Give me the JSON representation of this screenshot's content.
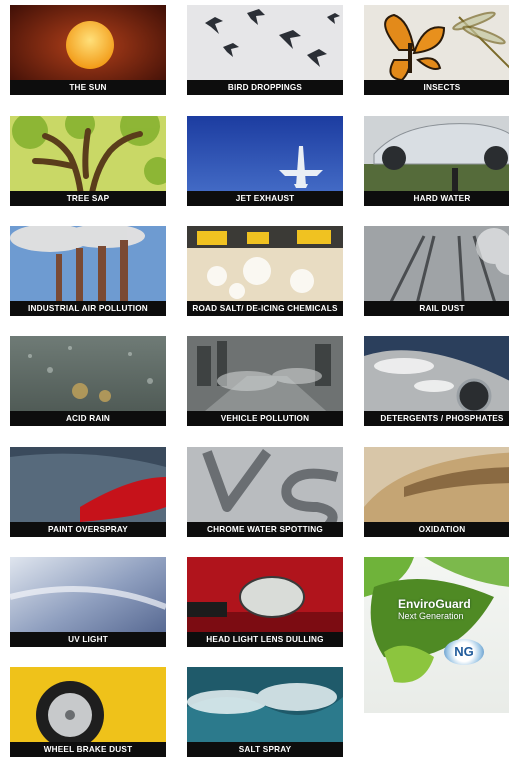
{
  "tiles": [
    {
      "id": "sun",
      "label": "THE SUN"
    },
    {
      "id": "bird",
      "label": "BIRD DROPPINGS"
    },
    {
      "id": "insects",
      "label": "INSECTS"
    },
    {
      "id": "treesap",
      "label": "TREE SAP"
    },
    {
      "id": "jet",
      "label": "JET EXHAUST"
    },
    {
      "id": "hardwater",
      "label": "HARD WATER"
    },
    {
      "id": "industrial",
      "label": "INDUSTRIAL AIR POLLUTION"
    },
    {
      "id": "roadsalt",
      "label": "ROAD SALT/ DE-ICING CHEMICALS"
    },
    {
      "id": "raildust",
      "label": "RAIL DUST"
    },
    {
      "id": "acidrain",
      "label": "ACID RAIN"
    },
    {
      "id": "vehicle",
      "label": "VEHICLE POLLUTION"
    },
    {
      "id": "detergents",
      "label": "DETERGENTS / PHOSPHATES"
    },
    {
      "id": "overspray",
      "label": "PAINT OVERSPRAY"
    },
    {
      "id": "chrome",
      "label": "CHROME WATER SPOTTING"
    },
    {
      "id": "oxidation",
      "label": "OXIDATION"
    },
    {
      "id": "uv",
      "label": "UV LIGHT"
    },
    {
      "id": "headlight",
      "label": "HEAD LIGHT LENS DULLING"
    },
    {
      "id": "brake",
      "label": "WHEEL BRAKE DUST"
    },
    {
      "id": "saltspray",
      "label": "SALT SPRAY"
    }
  ],
  "brand": {
    "name": "EnviroGuard",
    "subtitle": "Next Generation",
    "badge": "NG",
    "colors": {
      "leaf": "#6fb33a",
      "badge_blue": "#3d7bb5"
    }
  }
}
